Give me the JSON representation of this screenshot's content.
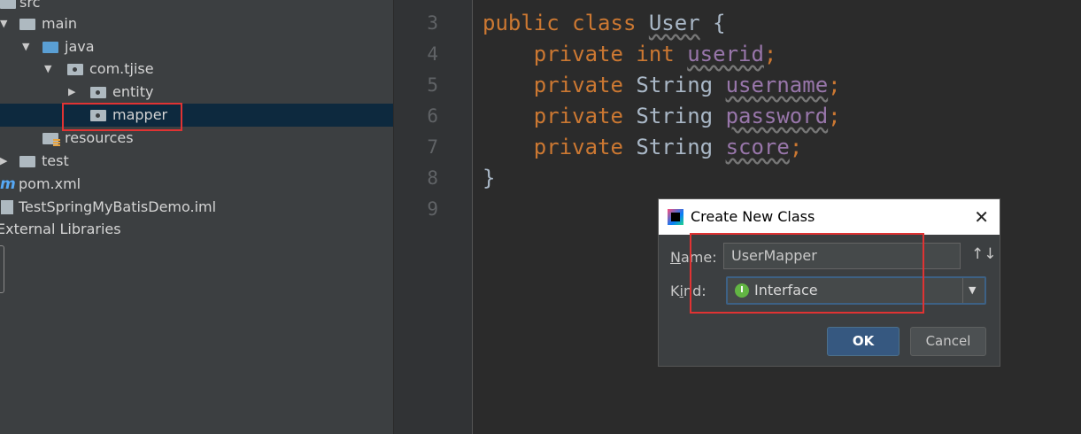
{
  "tree": {
    "src": "src",
    "main": "main",
    "java": "java",
    "package": "com.tjise",
    "entity": "entity",
    "mapper": "mapper",
    "resources": "resources",
    "test": "test",
    "pom_icon": "m",
    "pom": "pom.xml",
    "iml": "TestSpringMyBatisDemo.iml",
    "external_libraries": "External Libraries"
  },
  "gutter": {
    "line_numbers": [
      "3",
      "4",
      "5",
      "6",
      "7",
      "8",
      "9"
    ]
  },
  "code": {
    "public": "public",
    "class": "class",
    "class_name": "User",
    "open_brace": " {",
    "private": "private",
    "int": "int",
    "string": "String",
    "field_userid": "userid",
    "field_username": "username",
    "field_password": "password",
    "field_score": "score",
    "semicolon": ";",
    "close_brace": "}"
  },
  "dialog": {
    "title": "Create New Class",
    "close": "✕",
    "name_label_mnemonic": "N",
    "name_label_rest": "ame:",
    "name_value": "UserMapper",
    "sort_icon": "↑↓",
    "kind_label_pre": "K",
    "kind_label_mnemonic": "i",
    "kind_label_rest": "nd:",
    "kind_icon": "I",
    "kind_value": "Interface",
    "dropdown_arrow": "▼",
    "ok": "OK",
    "cancel": "Cancel"
  },
  "colors": {
    "keyword": "#cc7832",
    "field": "#9876aa",
    "highlight": "#e03333",
    "selection": "#0d293e"
  }
}
